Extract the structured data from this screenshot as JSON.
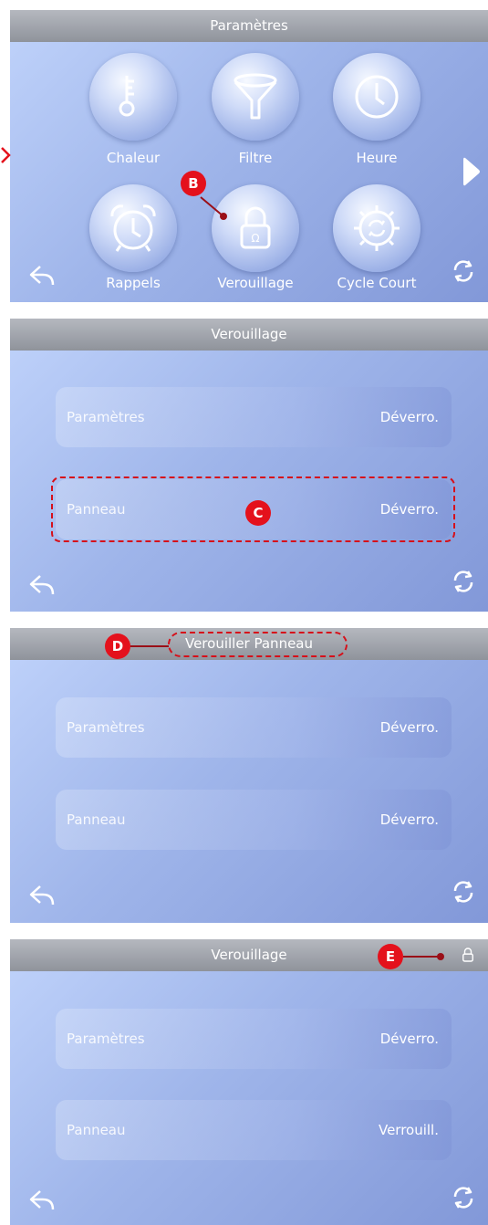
{
  "colors": {
    "accent": "#e4111c",
    "titlebar": "#9da1a8",
    "panel_bg": "#a7bbee"
  },
  "screen1": {
    "title": "Paramètres",
    "icons": [
      {
        "label": "Chaleur",
        "icon": "thermometer-icon"
      },
      {
        "label": "Filtre",
        "icon": "filter-funnel-icon"
      },
      {
        "label": "Heure",
        "icon": "clock-icon"
      },
      {
        "label": "Rappels",
        "icon": "alarm-clock-icon"
      },
      {
        "label": "Verouillage",
        "icon": "padlock-icon"
      },
      {
        "label": "Cycle Court",
        "icon": "cycle-gear-icon"
      }
    ],
    "callout": "B"
  },
  "screen2": {
    "title": "Verouillage",
    "rows": [
      {
        "label": "Paramètres",
        "value": "Déverro."
      },
      {
        "label": "Panneau",
        "value": "Déverro."
      }
    ],
    "callout": "C"
  },
  "screen3": {
    "title": "Verouiller Panneau",
    "rows": [
      {
        "label": "Paramètres",
        "value": "Déverro."
      },
      {
        "label": "Panneau",
        "value": "Déverro."
      }
    ],
    "callout": "D"
  },
  "screen4": {
    "title": "Verouillage",
    "rows": [
      {
        "label": "Paramètres",
        "value": "Déverro."
      },
      {
        "label": "Panneau",
        "value": "Verrouill."
      }
    ],
    "callout": "E"
  }
}
